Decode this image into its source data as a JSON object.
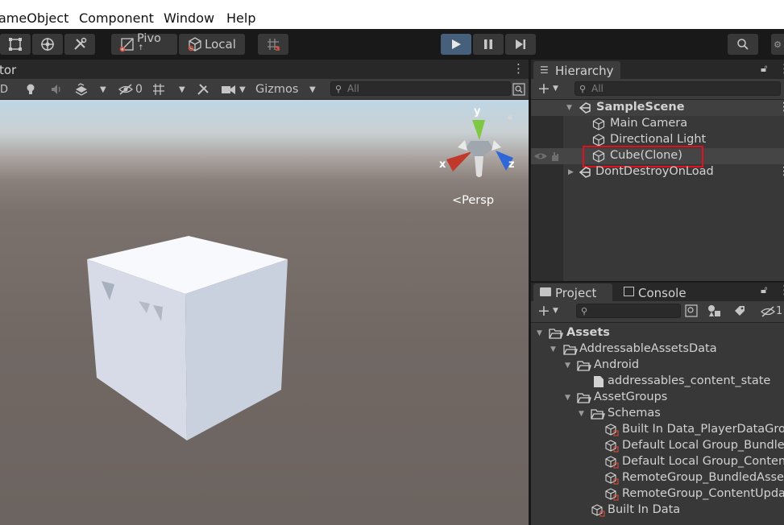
{
  "menu": {
    "items": [
      "ameObject",
      "Component",
      "Window",
      "Help"
    ]
  },
  "toolbar": {
    "pivot_label": "Pivo",
    "local_label": "Local"
  },
  "scene": {
    "tab_label": "tor",
    "mode_label": "D",
    "hidden_count": "0",
    "gizmos_label": "Gizmos",
    "search_placeholder": "All",
    "gizmo_axis_x": "x",
    "gizmo_axis_y": "y",
    "gizmo_axis_z": "z",
    "projection_label": "Persp"
  },
  "hierarchy": {
    "tab_label": "Hierarchy",
    "search_placeholder": "All",
    "rows": [
      {
        "label": "SampleScene"
      },
      {
        "label": "Main Camera"
      },
      {
        "label": "Directional Light"
      },
      {
        "label": "Cube(Clone)"
      },
      {
        "label": "DontDestroyOnLoad"
      }
    ]
  },
  "project": {
    "tab_label": "Project",
    "console_tab_label": "Console",
    "hidden_count": "1",
    "rows": [
      {
        "label": "Assets"
      },
      {
        "label": "AddressableAssetsData"
      },
      {
        "label": "Android"
      },
      {
        "label": "addressables_content_state"
      },
      {
        "label": "AssetGroups"
      },
      {
        "label": "Schemas"
      },
      {
        "label": "Built In Data_PlayerDataGrou"
      },
      {
        "label": "Default Local Group_Bundlec"
      },
      {
        "label": "Default Local Group_Conten"
      },
      {
        "label": "RemoteGroup_BundledAsset"
      },
      {
        "label": "RemoteGroup_ContentUpdat"
      },
      {
        "label": "Built In Data"
      }
    ]
  },
  "colors": {
    "highlight_box": "#e0101e",
    "play_button": "#46607c",
    "panel_bg": "#383838"
  }
}
